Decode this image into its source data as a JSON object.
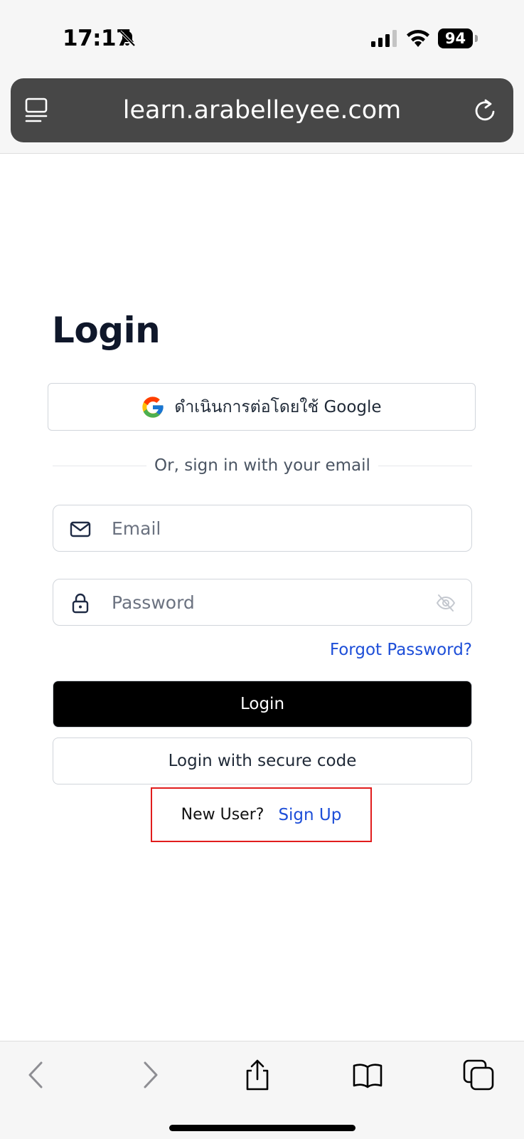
{
  "status_bar": {
    "time": "17:17",
    "battery": "94",
    "icons": [
      "bell-slash-icon",
      "cellular-signal-icon",
      "wifi-icon",
      "battery-icon"
    ]
  },
  "browser": {
    "url": "learn.arabelleyee.com",
    "icons": [
      "tabs-overview-icon",
      "reload-icon"
    ]
  },
  "page": {
    "title": "Login",
    "google_button_label": "ดำเนินการต่อโดยใช้ Google",
    "divider_text": "Or, sign in with your email",
    "email": {
      "placeholder": "Email",
      "value": ""
    },
    "password": {
      "placeholder": "Password",
      "value": ""
    },
    "forgot_password": "Forgot Password?",
    "login_button": "Login",
    "secure_code_button": "Login with secure code",
    "new_user_text": "New User?",
    "sign_up_link": "Sign Up"
  },
  "toolbar": {
    "icons": [
      "back-arrow-icon",
      "forward-arrow-icon",
      "share-icon",
      "bookmarks-icon",
      "tabs-icon"
    ]
  },
  "colors": {
    "link": "#1d4ed8",
    "primary_button": "#000000",
    "highlight_border": "#e11d1d",
    "url_bar": "#474747"
  }
}
